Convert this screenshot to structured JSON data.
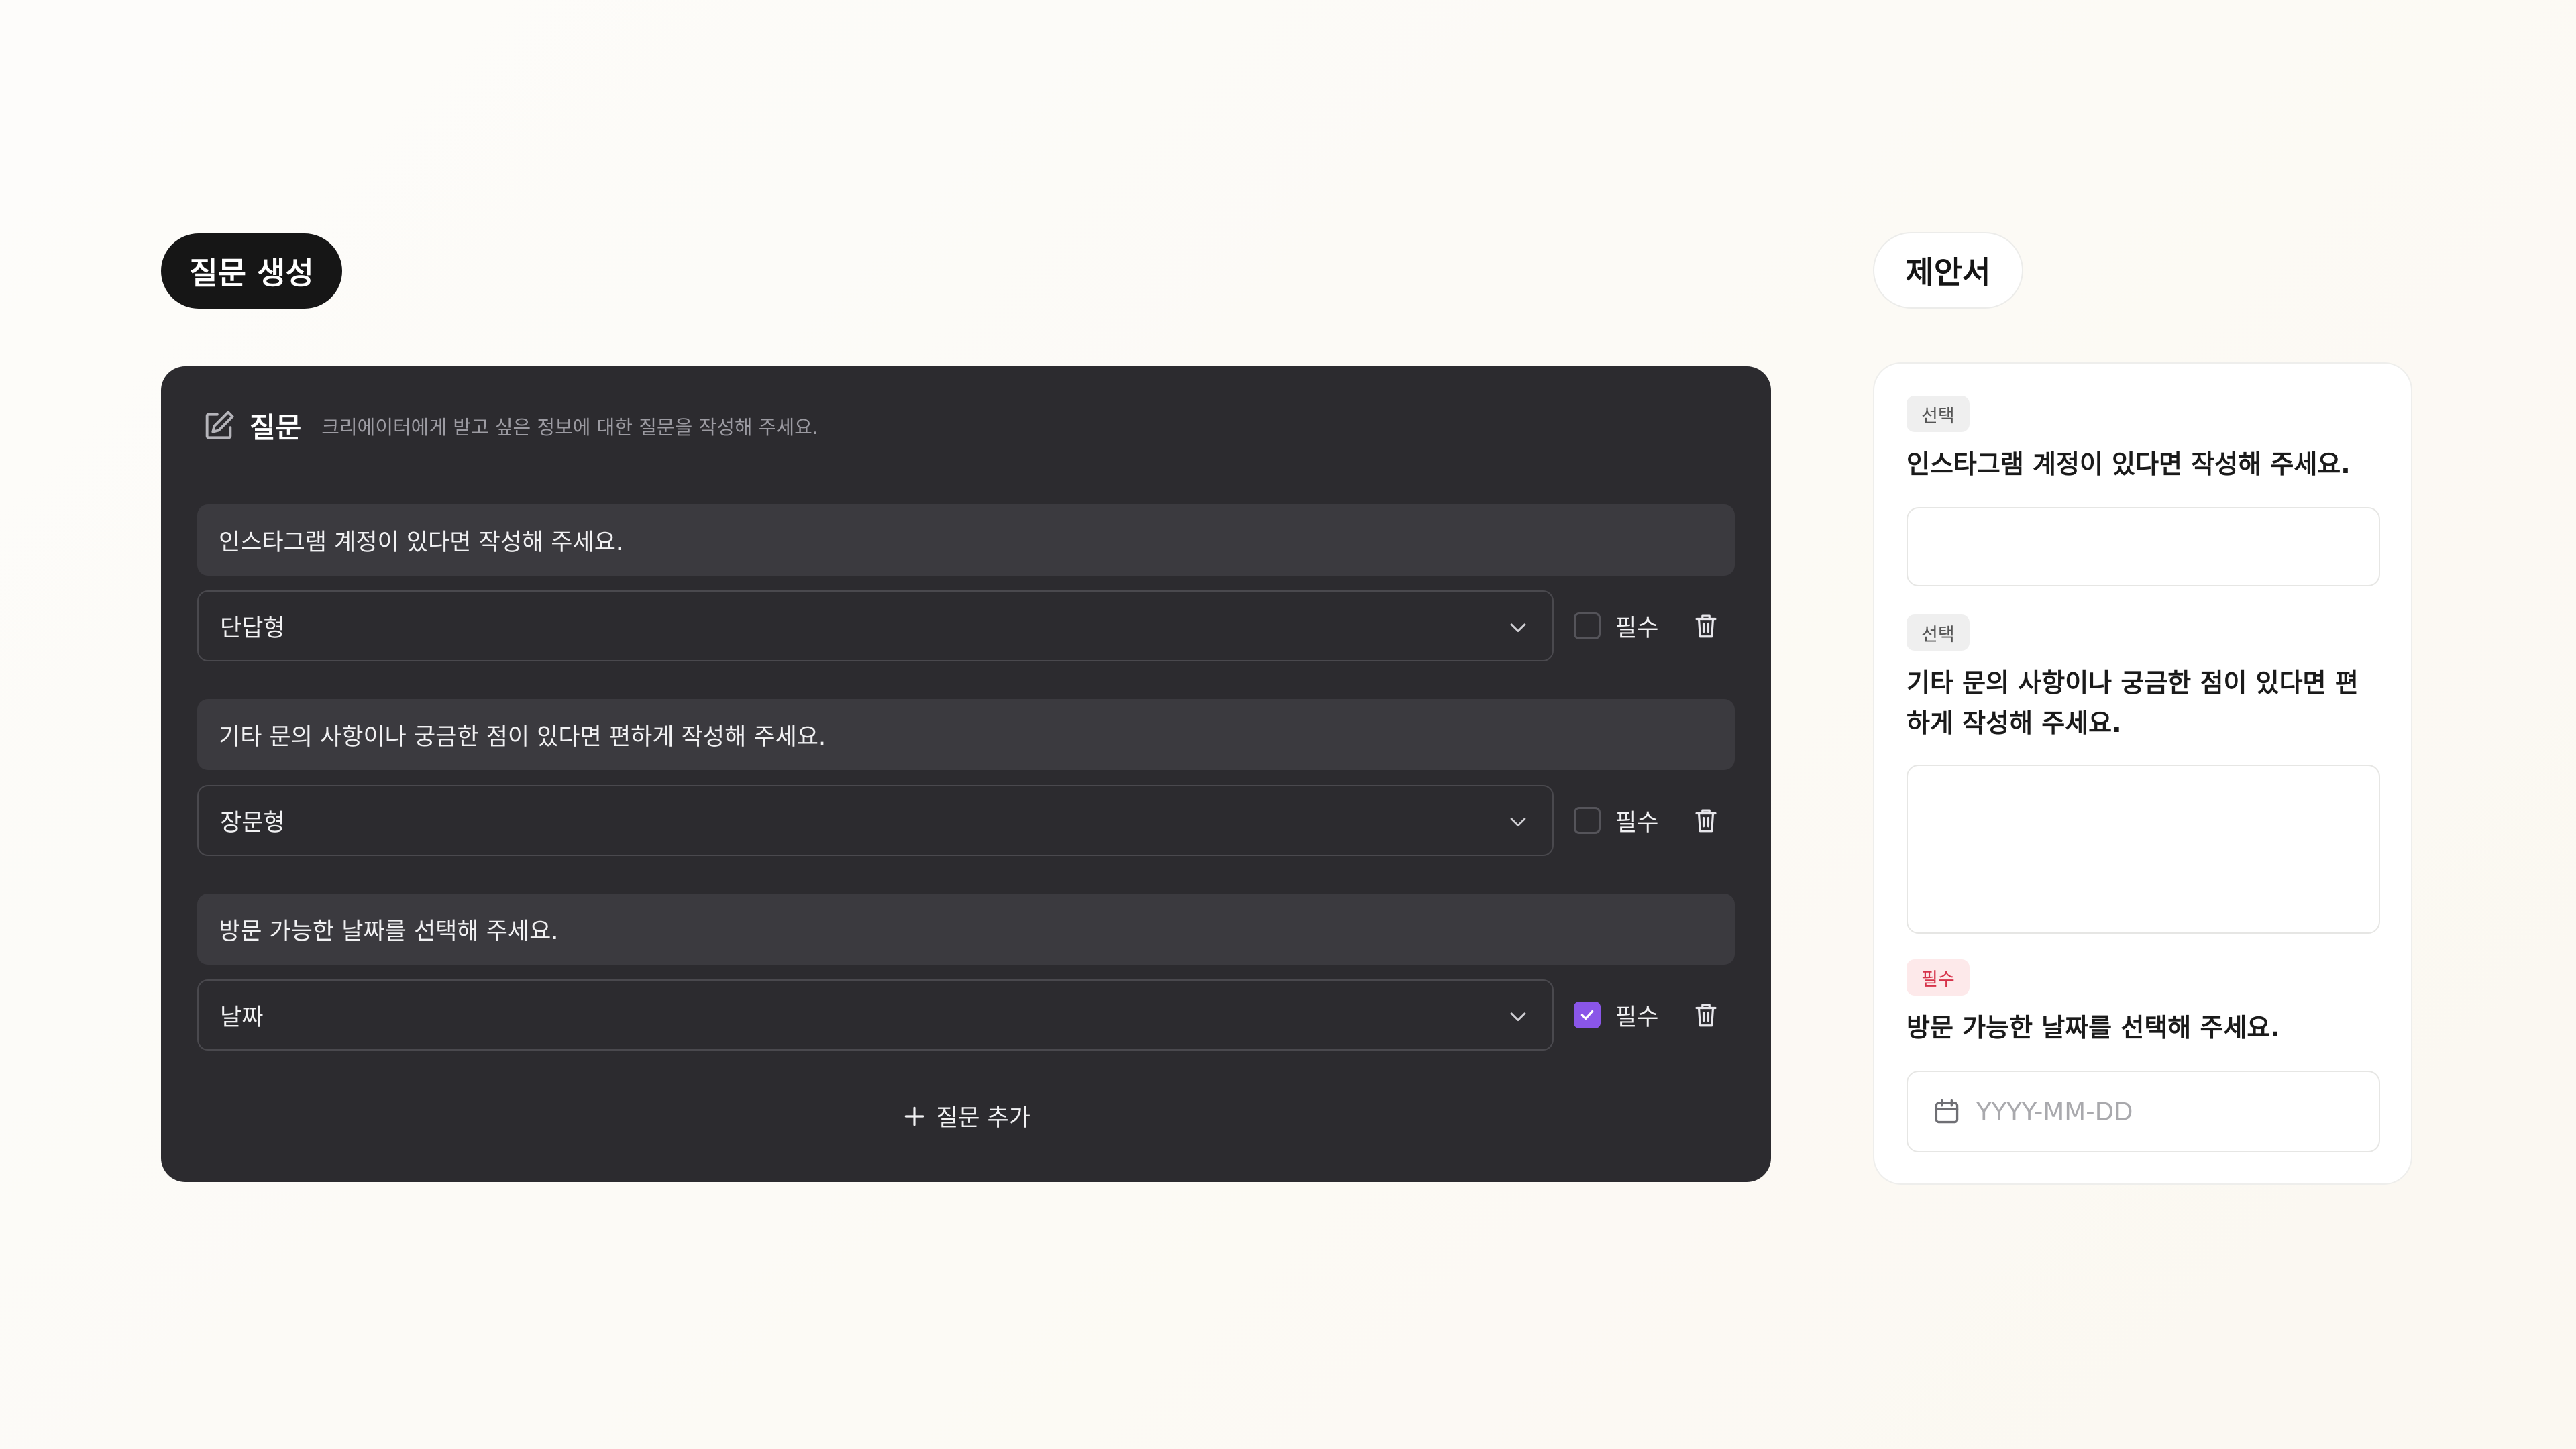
{
  "header": {
    "create_label": "질문 생성",
    "proposal_label": "제안서"
  },
  "editor": {
    "title": "질문",
    "hint": "크리에이터에게 받고 싶은 정보에 대한 질문을 작성해 주세요.",
    "required_label": "필수",
    "add_label": "질문 추가",
    "questions": [
      {
        "text": "인스타그램 계정이 있다면 작성해 주세요.",
        "type": "단답형",
        "required": false
      },
      {
        "text": "기타 문의 사항이나 궁금한 점이 있다면 편하게 작성해 주세요.",
        "type": "장문형",
        "required": false
      },
      {
        "text": "방문 가능한 날짜를 선택해 주세요.",
        "type": "날짜",
        "required": true
      }
    ]
  },
  "preview": {
    "items": [
      {
        "badge": "선택",
        "question": "인스타그램 계정이 있다면 작성해 주세요."
      },
      {
        "badge": "선택",
        "question": "기타 문의 사항이나 궁금한 점이 있다면 편하게 작성해 주세요."
      },
      {
        "badge": "필수",
        "question": "방문 가능한 날짜를 선택해 주세요.",
        "placeholder": "YYYY-MM-DD"
      }
    ]
  },
  "colors": {
    "accent": "#8a56e8",
    "panel": "#2c2b2f",
    "required_badge": "#d6334a"
  }
}
